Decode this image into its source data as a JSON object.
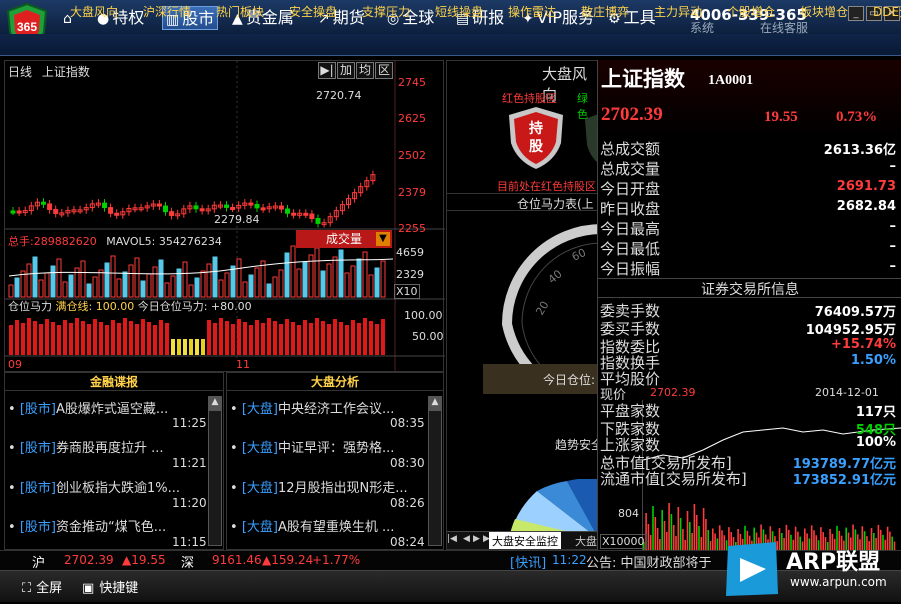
{
  "app": {
    "logo_text": "365",
    "phone": "4006-339-365",
    "nav": [
      {
        "label": "特权",
        "icon": "●"
      },
      {
        "label": "股市",
        "icon": "▥"
      },
      {
        "label": "贵金属",
        "icon": "▲"
      },
      {
        "label": "期货",
        "icon": "↗"
      },
      {
        "label": "全球",
        "icon": "◎"
      },
      {
        "label": "研报",
        "icon": "▤"
      },
      {
        "label": "VIP服务",
        "icon": "✦"
      },
      {
        "label": "工具",
        "icon": "⚙"
      }
    ],
    "nav_overlap": "系统",
    "nav_overlap2": "在线客服"
  },
  "subnav": [
    "大盘风向",
    "沪深行情",
    "热门板块",
    "安全操盘",
    "支撑压力",
    "短线操盘",
    "操作雷达",
    "散庄博弈",
    "主力异动",
    "个股增仓",
    "板块增仓",
    "DDE资"
  ],
  "chart": {
    "period": "日线",
    "name": "上证指数",
    "buttons": [
      "▶|",
      "加",
      "均",
      "区"
    ],
    "price_labels": [
      "2745",
      "2625",
      "2502",
      "2379",
      "2255"
    ],
    "high_label": "2720.74",
    "low_label": "2279.84",
    "volume_text_label": "总手:",
    "volume_value": "289882620",
    "mavol_text": "MAVOL5: 354276234",
    "volume_button": "成交量",
    "vol_labels": [
      "4659",
      "2329",
      "X10"
    ],
    "pos_text_label": "仓位马力",
    "pos_full": "满仓线: 100.00",
    "pos_today": "今日仓位马力: +80.00",
    "pos_labels": [
      "100.00",
      "50.00"
    ],
    "months": [
      "09",
      "11"
    ]
  },
  "news_left": {
    "title": "金融谍报",
    "items": [
      {
        "tag": "[股市]",
        "text": "A股爆炸式逼空藏...",
        "time": "11:25"
      },
      {
        "tag": "[股市]",
        "text": "券商股再度拉升 ...",
        "time": "11:21"
      },
      {
        "tag": "[股市]",
        "text": "创业板指大跌逾1%...",
        "time": "11:20"
      },
      {
        "tag": "[股市]",
        "text": "资金推动“煤飞色...",
        "time": "11:15"
      }
    ]
  },
  "news_right": {
    "title": "大盘分析",
    "items": [
      {
        "tag": "[大盘]",
        "text": "中央经济工作会议...",
        "time": "08:35"
      },
      {
        "tag": "[大盘]",
        "text": "中证早评：强势格...",
        "time": "08:30"
      },
      {
        "tag": "[大盘]",
        "text": "12月股指出现N形走...",
        "time": "08:26"
      },
      {
        "tag": "[大盘]",
        "text": "A股有望重焕生机 ...",
        "time": "08:24"
      }
    ]
  },
  "mid": {
    "title": "大盘风向",
    "red_zone": "红色持股区",
    "green_zone": "绿色",
    "hold_label": "持股",
    "zone_note": "目前处在红色持股区",
    "gauge_title": "仓位马力表(上",
    "gauge_ticks": [
      "20",
      "40",
      "60"
    ],
    "today_label": "今日仓位:",
    "trend_label": "趋势安全",
    "tab_active": "大盘安全监控",
    "tab_next": "大盘"
  },
  "index": {
    "name": "上证指数",
    "code": "1A0001",
    "price": "2702.39",
    "change": "19.55",
    "change_pct": "0.73%",
    "rows": [
      {
        "label": "总成交额",
        "value": "2613.36亿"
      },
      {
        "label": "总成交量",
        "value": "–"
      },
      {
        "label": "今日开盘",
        "value": "2691.73"
      },
      {
        "label": "昨日收盘",
        "value": "2682.84"
      },
      {
        "label": "今日最高",
        "value": "–"
      },
      {
        "label": "今日最低",
        "value": "–"
      },
      {
        "label": "今日振幅",
        "value": "–"
      }
    ],
    "exchange_title": "证券交易所信息",
    "exch_rows": [
      {
        "label": "委卖手数",
        "value": "76409.57万"
      },
      {
        "label": "委买手数",
        "value": "104952.95万"
      },
      {
        "label": "指数委比",
        "value": "+15.74%"
      },
      {
        "label": "指数换手",
        "value": "1.50%"
      },
      {
        "label": "平均股价",
        "value": ""
      },
      {
        "label": "平盘家数",
        "value": "117只"
      },
      {
        "label": "下跌家数",
        "value": "548只"
      },
      {
        "label": "上涨家数",
        "value": "100%"
      },
      {
        "label": "总市值[交易所发布]",
        "value": "193789.77亿元"
      },
      {
        "label": "流通市值[交易所发布]",
        "value": "173852.91亿元"
      }
    ],
    "overlay_label": "现价",
    "overlay_price": "2702.39",
    "overlay_date": "2014-12-01",
    "mini_label": "804",
    "mini_x10000": "X10000",
    "scroll_text": "快讯",
    "scroll_time": "11:22",
    "scroll_msg": "公告: 中国财政部将于"
  },
  "status": {
    "sh_label": "沪",
    "sh_value": "2702.39",
    "sh_change": "▲19.55",
    "sz_label": "深",
    "sz_value": "9161.46",
    "sz_change": "▲159.24",
    "sz_pct": "+1.77%"
  },
  "bottom": {
    "fullscreen": "全屏",
    "shortcut": "快捷键",
    "watermark_brand": "ARP联盟",
    "watermark_url": "www.arpun.com"
  },
  "colors": {
    "up": "#ff3b3b",
    "down": "#00d000",
    "accent": "#ffd24a",
    "link": "#3aa0ff"
  }
}
